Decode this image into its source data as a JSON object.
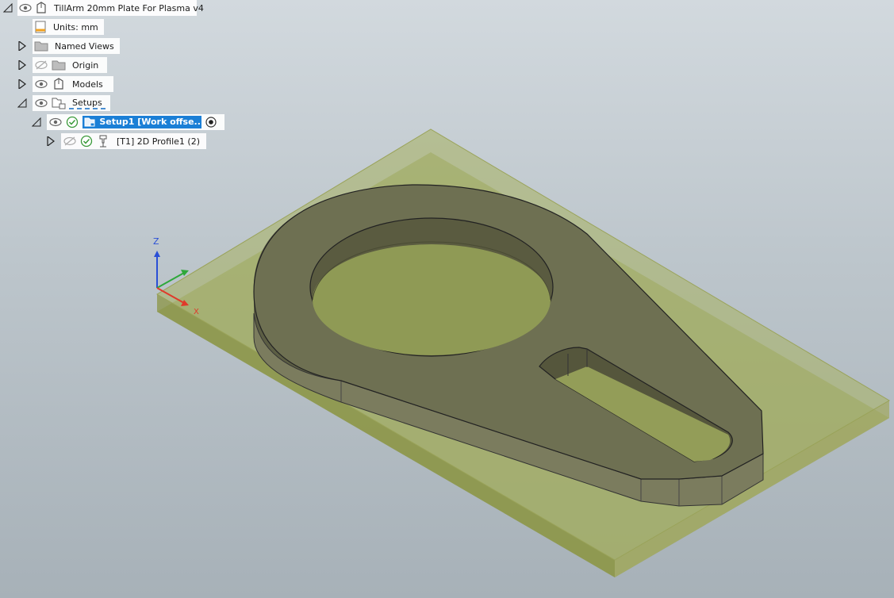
{
  "browser": {
    "root": {
      "label": "TillArm 20mm Plate For Plasma v4",
      "icon": "component-icon"
    },
    "units": {
      "label": "Units: mm",
      "icon": "ruler-icon"
    },
    "named_views": {
      "label": "Named Views",
      "icon": "folder-icon"
    },
    "origin": {
      "label": "Origin",
      "icon": "folder-icon",
      "visible": false
    },
    "models": {
      "label": "Models",
      "icon": "component-icon"
    },
    "setups": {
      "label": "Setups",
      "icon": "setups-folder-icon"
    },
    "setup1": {
      "label": "Setup1 [Work offse...",
      "icon": "setup-icon",
      "status": "ok",
      "selected": true
    },
    "profile": {
      "label": "[T1] 2D Profile1 (2)",
      "icon": "tool-icon",
      "status": "ok",
      "visible": false
    }
  },
  "axes": {
    "z_label": "Z",
    "x_label": "X"
  },
  "colors": {
    "stock": "#9aa45e",
    "part": "#6e7052",
    "selection": "#1b7fd6",
    "ok_status": "#3a9a3a",
    "axis_x": "#e03a2a",
    "axis_y": "#2ea83a",
    "axis_z": "#2a4fd6"
  }
}
